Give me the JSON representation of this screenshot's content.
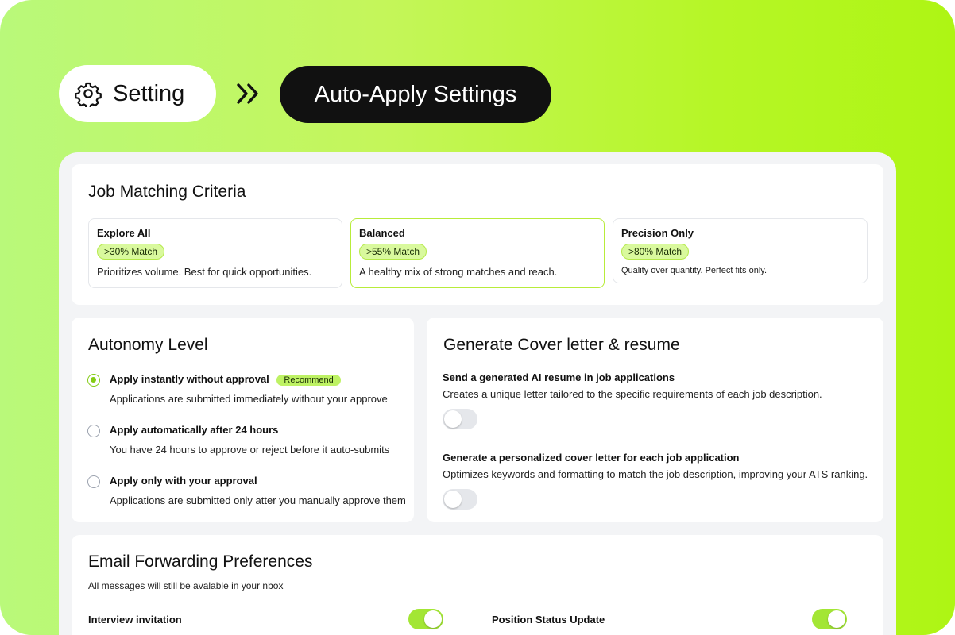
{
  "breadcrumb": {
    "root_label": "Setting",
    "current_label": "Auto-Apply Settings"
  },
  "job_matching": {
    "title": "Job Matching Criteria",
    "options": [
      {
        "title": "Explore All",
        "badge": ">30% Match",
        "description": "Prioritizes volume. Best for quick opportunities.",
        "selected": false
      },
      {
        "title": "Balanced",
        "badge": ">55% Match",
        "description": "A healthy mix of strong matches and reach.",
        "selected": true
      },
      {
        "title": "Precision Only",
        "badge": ">80% Match",
        "description": "Quality over quantity. Perfect fits only.",
        "selected": false
      }
    ]
  },
  "autonomy": {
    "title": "Autonomy Level",
    "options": [
      {
        "label": "Apply instantly without approval",
        "badge": "Recommend",
        "description": "Applications are submitted immediately without your approve",
        "selected": true
      },
      {
        "label": "Apply automatically after 24 hours",
        "description": "You have 24 hours to approve or reject before it auto-submits",
        "selected": false
      },
      {
        "label": "Apply only with your approval",
        "description": "Applications are submitted only atter you manually approve them",
        "selected": false
      }
    ]
  },
  "cover_letter": {
    "title": "Generate Cover letter & resume",
    "items": [
      {
        "title": "Send a generated AI resume in job applications",
        "description": "Creates a unique letter tailored to the specific requirements of each job description.",
        "enabled": false
      },
      {
        "title": "Generate a personalized cover letter for each job application",
        "description": "Optimizes keywords and formatting to match the job description, improving your ATS ranking.",
        "enabled": false
      }
    ]
  },
  "email": {
    "title": "Email Forwarding Preferences",
    "subtitle": "All messages will still be avalable in your nbox",
    "items": [
      {
        "label": "Interview invitation",
        "enabled": true
      },
      {
        "label": "Position Status Update",
        "enabled": true
      }
    ]
  },
  "colors": {
    "accent": "#a3e635",
    "pill_bg": "#d9f99d",
    "dark": "#111111"
  }
}
